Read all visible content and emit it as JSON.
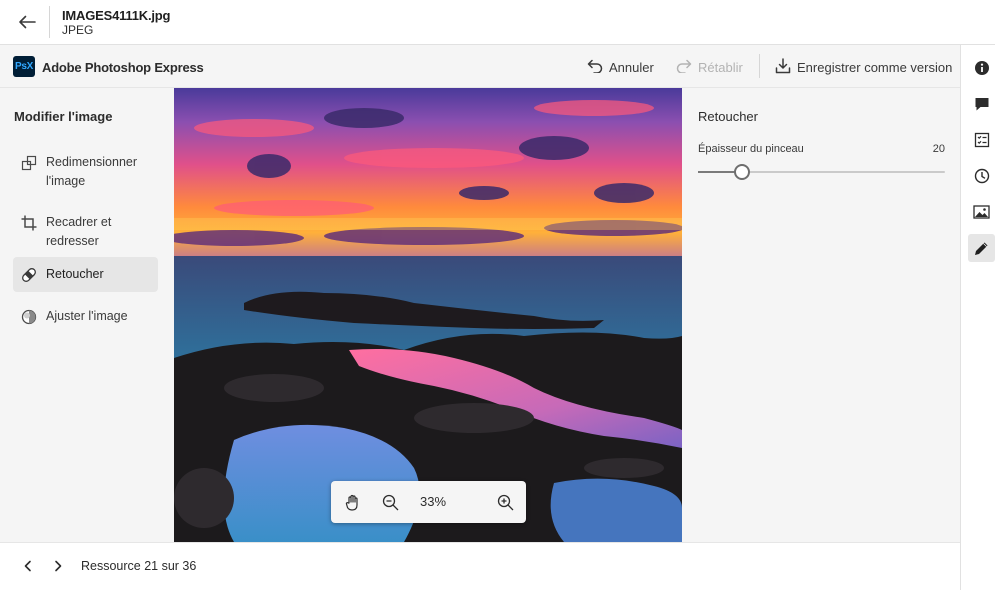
{
  "header": {
    "file_name": "IMAGES4111K.jpg",
    "file_type": "JPEG"
  },
  "app": {
    "logo_text": "PsX",
    "name": "Adobe Photoshop Express",
    "brand_color": "#001e36",
    "brand_accent": "#31a8ff",
    "undo_label": "Annuler",
    "redo_label": "Rétablir",
    "save_label": "Enregistrer comme version"
  },
  "left_panel": {
    "title": "Modifier l'image",
    "tools": [
      {
        "line1": "Redimensionner",
        "line2": "l'image",
        "icon": "resize-icon"
      },
      {
        "line1": "Recadrer et",
        "line2": "redresser",
        "icon": "crop-icon"
      },
      {
        "line1": "Retoucher",
        "line2": "",
        "icon": "bandage-icon"
      },
      {
        "line1": "Ajuster l'image",
        "line2": "",
        "icon": "adjust-icon"
      }
    ],
    "active_tool": "Retoucher"
  },
  "canvas": {
    "zoom_level": "33%"
  },
  "properties": {
    "title": "Retoucher",
    "brush_label": "Épaisseur du pinceau",
    "brush_value": "20",
    "brush_fraction": 0.18
  },
  "rail": [
    "info-icon",
    "comment-icon",
    "checklist-icon",
    "history-icon",
    "image-icon",
    "edit-pencil-icon"
  ],
  "footer": {
    "resource_counter": "Ressource 21 sur 36"
  }
}
